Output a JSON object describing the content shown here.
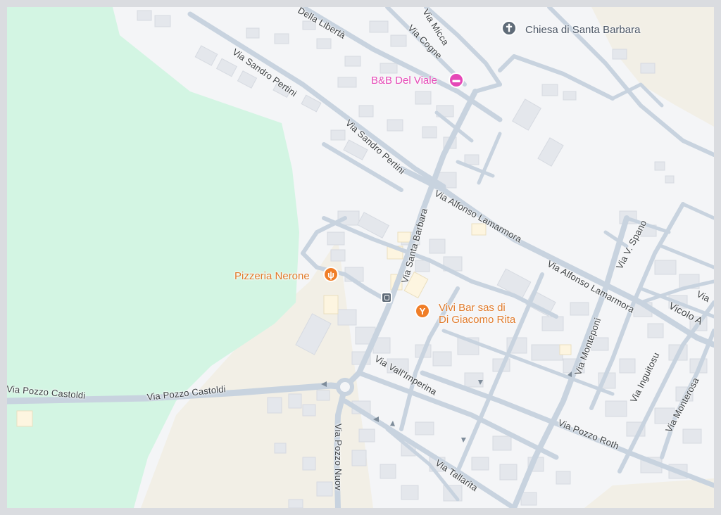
{
  "colors": {
    "background": "#f4f5f7",
    "park": "#d3f5e3",
    "sand": "#f2efe6",
    "road": "#c8d3df",
    "building": "#e4e7ec",
    "church": "#5f6b78",
    "hotel": "#e548b7",
    "food": "#f07e28"
  },
  "pois": {
    "church": {
      "name": "Chiesa di Santa Barbara",
      "icon": "cross-icon"
    },
    "hotel": {
      "name": "B&B Del Viale",
      "icon": "bed-icon"
    },
    "pizzeria": {
      "name": "Pizzeria Nerone",
      "icon": "fork-knife-icon"
    },
    "bar": {
      "line1": "Vivi Bar sas di",
      "line2": "Di Giacomo Rita",
      "icon": "cocktail-icon"
    }
  },
  "streets": {
    "della_liberta": "Della Libertà",
    "micca": "Via Micca",
    "cogne": "Via Cogne",
    "sandro_pertini_1": "Via Sandro Pertini",
    "sandro_pertini_2": "Via Sandro Pertini",
    "santa_barbara": "Via Santa Barbara",
    "lamarmora_1": "Via Alfonso Lamarmora",
    "lamarmora_2": "Via Alfonso Lamarmora",
    "v_spano": "Via V. Spano",
    "via_partial": "Via",
    "vicolo": "Vicolo A",
    "montepont": "Via Monteponi",
    "inguitosu": "Via Inguitosu",
    "monterosa": "Via Monterosa",
    "val_imperina": "Via Vall'Imperina",
    "pozzo_castoldi_1": "Via Pozzo Castoldi",
    "pozzo_castoldi_2": "Via Pozzo Castoldi",
    "pozzo_nuovo": "Via Pozzo Nuov",
    "pozzo_roth": "Via Pozzo Roth",
    "tallarita": "Via Tallarita"
  }
}
